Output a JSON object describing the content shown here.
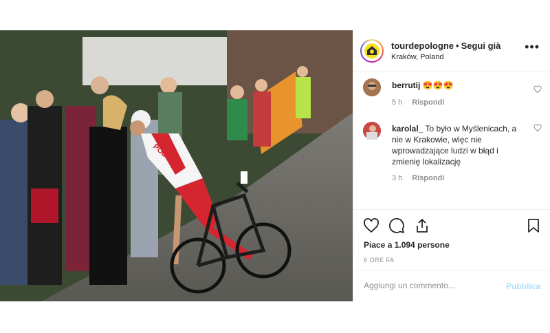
{
  "header": {
    "username": "tourdepologne",
    "separator": "•",
    "follow_label": "Segui già",
    "location": "Kraków, Poland",
    "more_label": "•••"
  },
  "photo": {
    "jersey_text": "POLSKA"
  },
  "comments": [
    {
      "user": "berrutij",
      "text": "😍😍😍",
      "age": "5 h",
      "reply_label": "Rispondi"
    },
    {
      "user": "karolal_",
      "text": "To było w Myślenicach, a nie w Krakowie, więc nie wprowadzające ludzi w błąd i zmienię lokalizację",
      "age": "3 h",
      "reply_label": "Rispondi"
    }
  ],
  "likes": "Piace a 1.094 persone",
  "timestamp": "6 ORE FA",
  "add_comment": {
    "placeholder": "Aggiungi un commento...",
    "publish_label": "Pubblica"
  },
  "colors": {
    "accent_disabled": "#b2dffc",
    "muted": "#8e8e8e",
    "text": "#262626"
  }
}
